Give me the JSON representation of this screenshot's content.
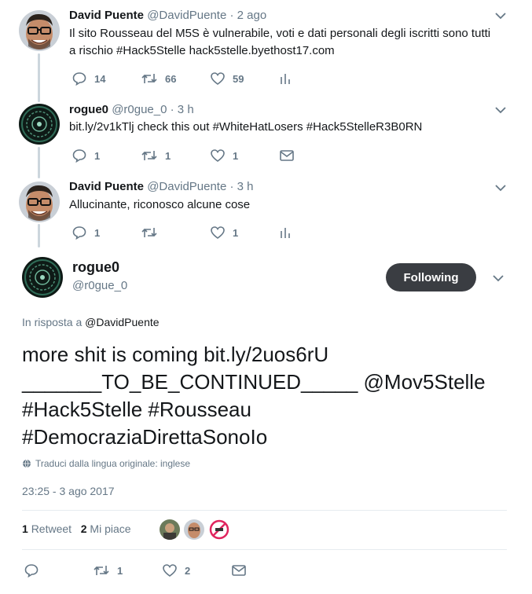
{
  "tweets": [
    {
      "name": "David Puente",
      "handle": "@DavidPuente",
      "time": "· 2 ago",
      "text_lines": [
        "Il sito Rousseau del M5S è vulnerabile, voti e dati personali degli iscritti sono tutti",
        "a rischio #Hack5Stelle hack5stelle.byethost17.com"
      ],
      "replies": "14",
      "retweets": "66",
      "likes": "59"
    },
    {
      "name": "rogue0",
      "handle": "@r0gue_0",
      "time": "· 3 h",
      "text_lines": [
        "bit.ly/2v1kTlj  check this out #WhiteHatLosers #Hack5StelleR3B0RN"
      ],
      "replies": "1",
      "retweets": "1",
      "likes": "1"
    },
    {
      "name": "David Puente",
      "handle": "@DavidPuente",
      "time": "· 3 h",
      "text_lines": [
        "Allucinante, riconosco alcune cose"
      ],
      "replies": "1",
      "retweets": "",
      "likes": "1"
    }
  ],
  "main": {
    "name": "rogue0",
    "handle": "@r0gue_0",
    "follow_label": "Following",
    "reply_prefix": "In risposta a",
    "reply_to": "@DavidPuente",
    "text_lines": [
      "more shit is coming bit.ly/2uos6rU",
      "_______TO_BE_CONTINUED_____ @Mov5Stelle",
      "#Hack5Stelle #Rousseau",
      "#DemocraziaDirettaSonoIo"
    ],
    "translate_label": "Traduci dalla lingua originale: inglese",
    "timestamp": "23:25 - 3 ago 2017",
    "retweet_count": "1",
    "retweet_label": "Retweet",
    "like_count": "2",
    "like_label": "Mi piace",
    "action_retweets": "1",
    "action_likes": "2"
  },
  "colors": {
    "accent_dark": "#3a3d42",
    "muted": "#657786",
    "text": "#14171a",
    "thread_line": "#ccd6dd"
  },
  "icons": [
    "reply-icon",
    "retweet-icon",
    "like-icon",
    "analytics-icon",
    "dm-icon",
    "chevron-down-icon",
    "globe-icon"
  ]
}
